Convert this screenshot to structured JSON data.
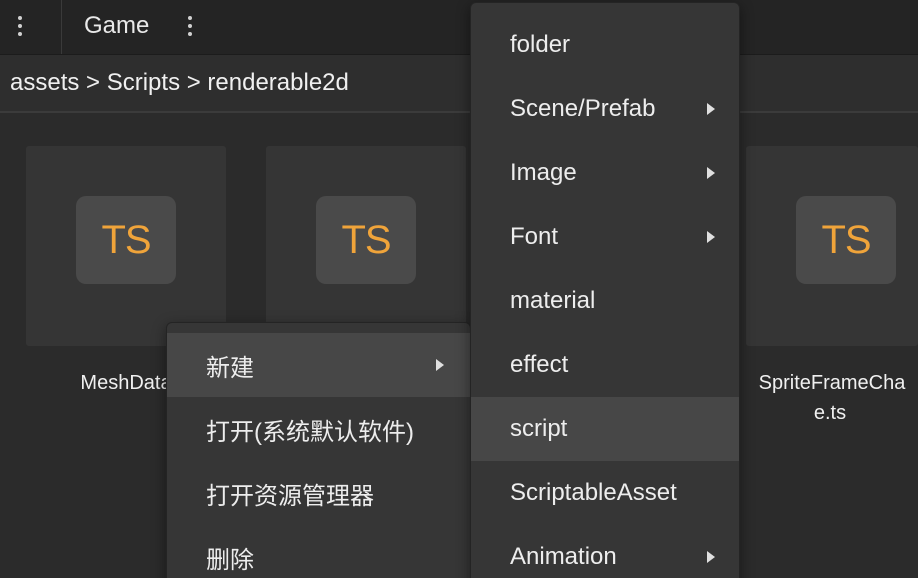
{
  "tab": {
    "title": "Game"
  },
  "breadcrumb": {
    "path": "assets > Scripts > renderable2d"
  },
  "assets": [
    {
      "badge": "TS",
      "label": "MeshData"
    },
    {
      "badge": "TS",
      "label": ""
    },
    {
      "badge": "TS",
      "label": "SpriteFrameCha",
      "label2": "e.ts"
    }
  ],
  "context_menu": {
    "items": [
      {
        "label": "新建",
        "has_submenu": true
      },
      {
        "label": "打开(系统默认软件)",
        "has_submenu": false
      },
      {
        "label": "打开资源管理器",
        "has_submenu": false
      },
      {
        "label": "删除",
        "has_submenu": false
      }
    ]
  },
  "new_submenu": {
    "items": [
      {
        "label": "folder",
        "has_submenu": false
      },
      {
        "label": "Scene/Prefab",
        "has_submenu": true
      },
      {
        "label": "Image",
        "has_submenu": true
      },
      {
        "label": "Font",
        "has_submenu": true
      },
      {
        "label": "material",
        "has_submenu": false
      },
      {
        "label": "effect",
        "has_submenu": false
      },
      {
        "label": "script",
        "has_submenu": false
      },
      {
        "label": "ScriptableAsset",
        "has_submenu": false
      },
      {
        "label": "Animation",
        "has_submenu": true
      }
    ],
    "highlighted": "script"
  },
  "colors": {
    "ts_badge_text": "#f0a43a",
    "menu_bg": "#363636",
    "menu_highlight": "#474747"
  }
}
